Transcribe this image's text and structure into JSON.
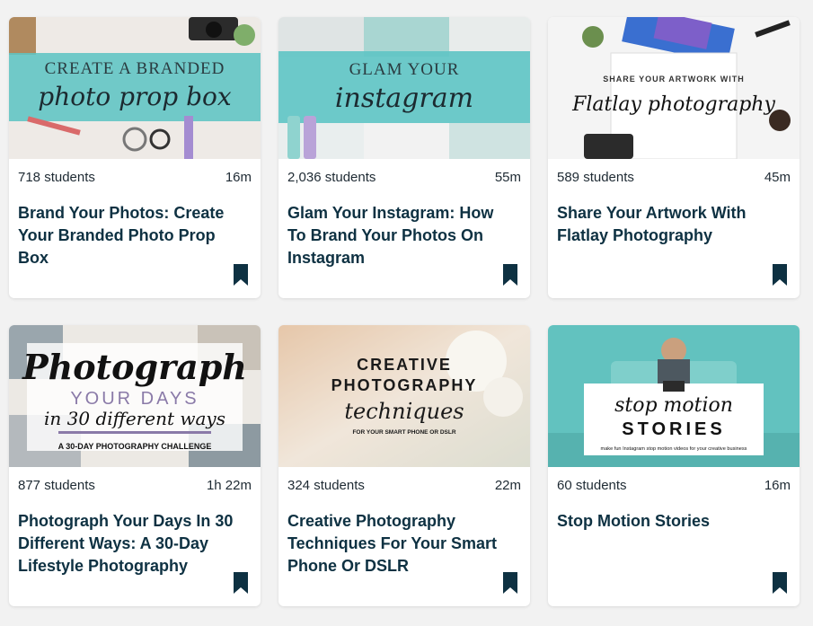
{
  "courses": [
    {
      "students": "718 students",
      "duration": "16m",
      "title": "Brand Your Photos: Create Your Branded Photo Prop Box",
      "thumb_line1": "CREATE A BRANDED",
      "thumb_line2": "photo prop box"
    },
    {
      "students": "2,036 students",
      "duration": "55m",
      "title": "Glam Your Instagram: How To Brand Your Photos On Instagram",
      "thumb_line1": "GLAM YOUR",
      "thumb_line2": "instagram"
    },
    {
      "students": "589 students",
      "duration": "45m",
      "title": "Share Your Artwork With Flatlay Photography",
      "thumb_line1": "SHARE YOUR ARTWORK WITH",
      "thumb_line2": "Flatlay photography"
    },
    {
      "students": "877 students",
      "duration": "1h 22m",
      "title": "Photograph Your Days In 30 Different Ways: A 30-Day Lifestyle Photography",
      "thumb_line1": "Photograph",
      "thumb_line2": "YOUR DAYS",
      "thumb_line3": "in 30 different ways",
      "thumb_line4": "A 30-DAY PHOTOGRAPHY CHALLENGE"
    },
    {
      "students": "324 students",
      "duration": "22m",
      "title": "Creative Photography Techniques For Your Smart Phone Or DSLR",
      "thumb_line1": "CREATIVE",
      "thumb_line2": "PHOTOGRAPHY",
      "thumb_line3": "techniques",
      "thumb_line4": "FOR YOUR SMART PHONE OR DSLR"
    },
    {
      "students": "60 students",
      "duration": "16m",
      "title": "Stop Motion Stories",
      "thumb_line1": "stop motion",
      "thumb_line2": "STORIES",
      "thumb_line3": "make fun Instagram stop motion videos for your creative business"
    }
  ],
  "icons": {
    "bookmark": "bookmark-icon"
  },
  "colors": {
    "accent_teal": "#5ec4c4",
    "title_navy": "#0e3142",
    "bookmark": "#0e3142"
  }
}
